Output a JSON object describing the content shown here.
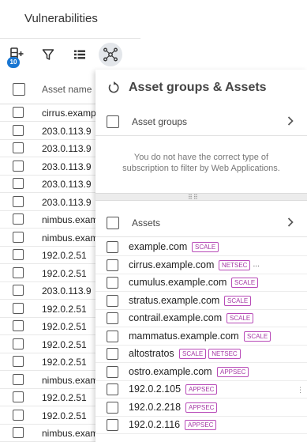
{
  "header": {
    "title": "Vulnerabilities"
  },
  "toolbar": {
    "badge_count": "10",
    "icons": [
      "add-column-icon",
      "filter-icon",
      "list-view-icon",
      "asset-graph-icon"
    ]
  },
  "table": {
    "header": "Asset name",
    "rows": [
      "cirrus.examp",
      "203.0.113.9",
      "203.0.113.9",
      "203.0.113.9",
      "203.0.113.9",
      "203.0.113.9",
      "nimbus.exam",
      "nimbus.exam",
      "192.0.2.51",
      "192.0.2.51",
      "203.0.113.9",
      "192.0.2.51",
      "192.0.2.51",
      "192.0.2.51",
      "192.0.2.51",
      "nimbus.exam",
      "192.0.2.51",
      "192.0.2.51",
      "nimbus.exam"
    ]
  },
  "panel": {
    "title": "Asset groups & Assets",
    "groups_label": "Asset groups",
    "notice_line1": "You do not have the correct type of",
    "notice_line2": "subscription to filter by Web Applications.",
    "assets_label": "Assets",
    "assets": [
      {
        "name": "example.com",
        "tags": [
          "SCALE"
        ],
        "truncated": false
      },
      {
        "name": "cirrus.example.com",
        "tags": [
          "NETSEC"
        ],
        "truncated": true
      },
      {
        "name": "cumulus.example.com",
        "tags": [
          "SCALE"
        ],
        "truncated": false
      },
      {
        "name": "stratus.example.com",
        "tags": [
          "SCALE"
        ],
        "truncated": false
      },
      {
        "name": "contrail.example.com",
        "tags": [
          "SCALE"
        ],
        "truncated": false
      },
      {
        "name": "mammatus.example.com",
        "tags": [
          "SCALE"
        ],
        "truncated": false
      },
      {
        "name": "altostratos",
        "tags": [
          "SCALE",
          "NETSEC"
        ],
        "truncated": false
      },
      {
        "name": "ostro.example.com",
        "tags": [
          "APPSEC"
        ],
        "truncated": false
      },
      {
        "name": "192.0.2.105",
        "tags": [
          "APPSEC"
        ],
        "truncated": false
      },
      {
        "name": "192.0.2.218",
        "tags": [
          "APPSEC"
        ],
        "truncated": false
      },
      {
        "name": "192.0.2.116",
        "tags": [
          "APPSEC"
        ],
        "truncated": false
      }
    ],
    "truncation_marker": "..."
  },
  "colors": {
    "accent": "#1976d2",
    "tag": "#a53aa5"
  }
}
